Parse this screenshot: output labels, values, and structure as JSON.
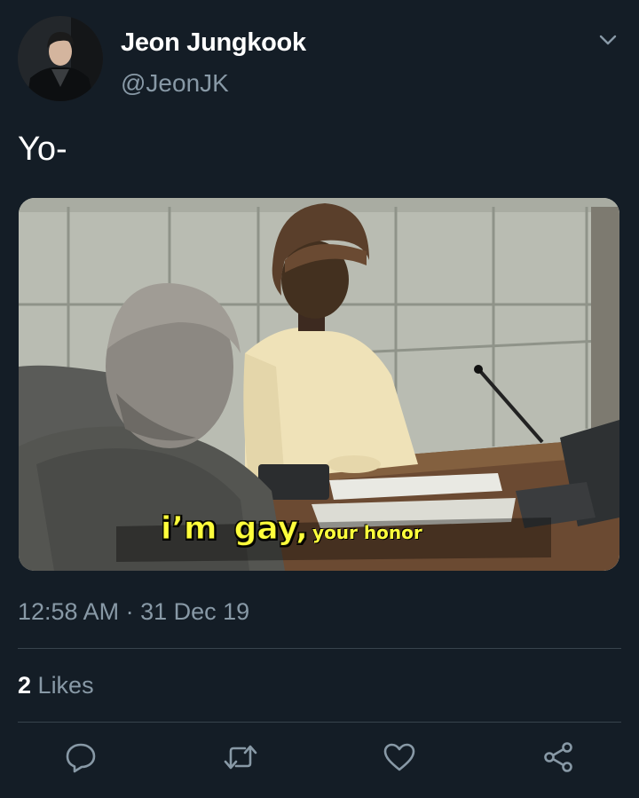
{
  "user": {
    "display_name": "Jeon Jungkook",
    "handle": "@JeonJK"
  },
  "tweet": {
    "text": "Yo-",
    "media": {
      "caption_1": "i’m",
      "caption_2": "gay,",
      "caption_3": "your honor"
    },
    "timestamp": "12:58 AM · 31 Dec 19"
  },
  "stats": {
    "likes_count": "2",
    "likes_label": "Likes"
  },
  "actions": {
    "reply_icon": "reply-icon",
    "retweet_icon": "retweet-icon",
    "like_icon": "heart-icon",
    "share_icon": "share-icon"
  },
  "colors": {
    "background": "#141d26",
    "secondary_text": "#8899a6",
    "divider": "#38444d",
    "caption_yellow": "#ffff3c"
  }
}
